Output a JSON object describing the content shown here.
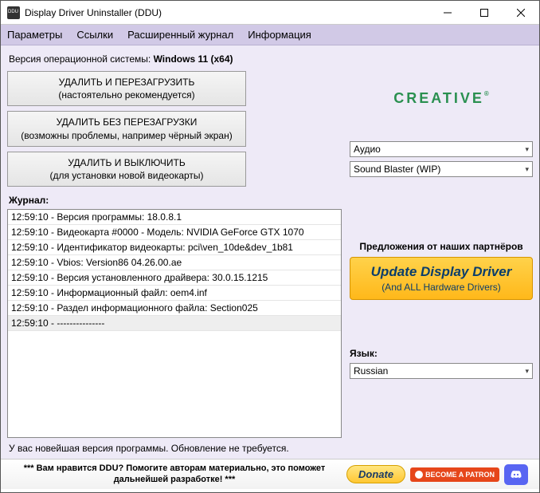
{
  "window": {
    "title": "Display Driver Uninstaller (DDU)"
  },
  "menu": {
    "params": "Параметры",
    "links": "Ссылки",
    "extlog": "Расширенный журнал",
    "info": "Информация"
  },
  "os": {
    "label": "Версия операционной системы: ",
    "value": "Windows 11 (x64)"
  },
  "buttons": {
    "b1_l1": "УДАЛИТЬ И ПЕРЕЗАГРУЗИТЬ",
    "b1_l2": "(настоятельно рекомендуется)",
    "b2_l1": "УДАЛИТЬ БЕЗ ПЕРЕЗАГРУЗКИ",
    "b2_l2": "(возможны проблемы, например чёрный экран)",
    "b3_l1": "УДАЛИТЬ И ВЫКЛЮЧИТЬ",
    "b3_l2": "(для установки новой видеокарты)"
  },
  "journal": {
    "label": "Журнал:",
    "rows": [
      "12:59:10 - Версия программы: 18.0.8.1",
      "12:59:10 - Видеокарта #0000 - Модель: NVIDIA GeForce GTX 1070",
      "12:59:10 - Идентификатор видеокарты: pci\\ven_10de&dev_1b81",
      "12:59:10 - Vbios: Version86 04.26.00.ae",
      "12:59:10 - Версия установленного драйвера: 30.0.15.1215",
      "12:59:10 - Информационный файл: oem4.inf",
      "12:59:10 - Раздел информационного файла: Section025",
      "12:59:10 - ---------------"
    ]
  },
  "status": "У вас новейшая версия программы. Обновление не требуется.",
  "right": {
    "logo": "CREATIVE",
    "type_selected": "Аудио",
    "device_selected": "Sound Blaster (WIP)",
    "partners_label": "Предложения от наших партнёров",
    "update_l1": "Update Display Driver",
    "update_l2": "(And ALL Hardware Drivers)",
    "lang_label": "Язык:",
    "lang_selected": "Russian"
  },
  "footer": {
    "text": "*** Вам нравится DDU? Помогите авторам материально, это поможет дальнейшей разработке! ***",
    "donate": "Donate",
    "patron": "BECOME A PATRON"
  }
}
